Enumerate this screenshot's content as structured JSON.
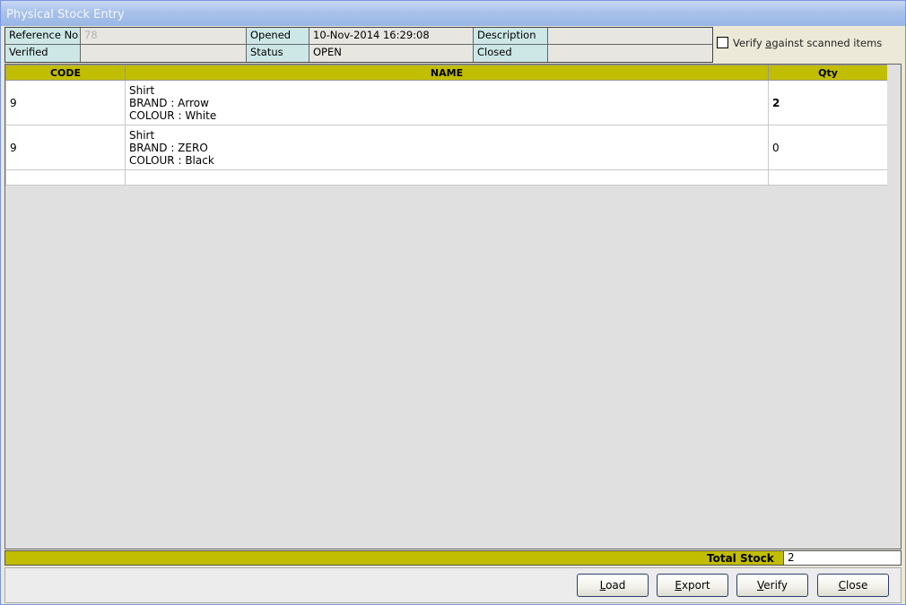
{
  "window": {
    "title": "Physical Stock Entry"
  },
  "info": {
    "reference_no_label": "Reference No",
    "reference_no_value": "78",
    "opened_label": "Opened",
    "opened_value": "10-Nov-2014 16:29:08",
    "description_label": "Description",
    "description_value": "",
    "verified_label": "Verified",
    "verified_value": "",
    "status_label": "Status",
    "status_value": "OPEN",
    "closed_label": "Closed",
    "closed_value": ""
  },
  "verify_option": {
    "label_pre": "Verify ",
    "label_accel": "a",
    "label_post": "gainst scanned items",
    "checked": false
  },
  "table": {
    "headers": {
      "code": "CODE",
      "name": "NAME",
      "qty": "Qty"
    },
    "rows": [
      {
        "code": "9",
        "name_line1": "Shirt",
        "name_line2": "BRAND : Arrow",
        "name_line3": "COLOUR : White",
        "qty": "2"
      },
      {
        "code": "9",
        "name_line1": "Shirt",
        "name_line2": "BRAND : ZERO",
        "name_line3": "COLOUR : Black",
        "qty": "0"
      }
    ]
  },
  "total": {
    "label": "Total Stock",
    "value": "2"
  },
  "buttons": {
    "load": {
      "accel": "L",
      "rest": "oad"
    },
    "export": {
      "accel": "E",
      "rest": "xport"
    },
    "verify": {
      "accel": "V",
      "rest": "erify"
    },
    "close": {
      "accel": "C",
      "rest": "lose"
    }
  },
  "colors": {
    "header_yellow": "#c1bd00",
    "label_cyan": "#cde7e7",
    "title_gradient": "#a9c2ea"
  }
}
